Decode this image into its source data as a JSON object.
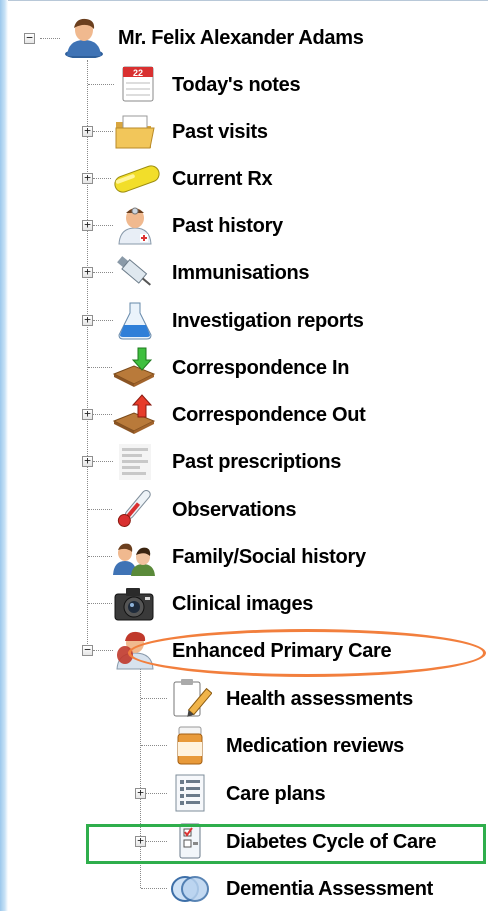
{
  "patient": {
    "name": "Mr. Felix Alexander Adams"
  },
  "items": [
    {
      "label": "Today's notes",
      "icon": "calendar-icon"
    },
    {
      "label": "Past visits",
      "icon": "folder-icon"
    },
    {
      "label": "Current Rx",
      "icon": "pill-icon"
    },
    {
      "label": "Past history",
      "icon": "doctor-icon"
    },
    {
      "label": "Immunisations",
      "icon": "syringe-icon"
    },
    {
      "label": "Investigation reports",
      "icon": "flask-icon"
    },
    {
      "label": "Correspondence In",
      "icon": "inbox-icon"
    },
    {
      "label": "Correspondence Out",
      "icon": "outbox-icon"
    },
    {
      "label": "Past prescriptions",
      "icon": "prescription-icon"
    },
    {
      "label": "Observations",
      "icon": "thermometer-icon"
    },
    {
      "label": "Family/Social history",
      "icon": "family-icon"
    },
    {
      "label": "Clinical images",
      "icon": "camera-icon"
    },
    {
      "label": "Enhanced Primary Care",
      "icon": "epc-icon"
    }
  ],
  "epc_children": [
    {
      "label": "Health assessments",
      "icon": "clipboard-pen-icon"
    },
    {
      "label": "Medication reviews",
      "icon": "pill-bottle-icon"
    },
    {
      "label": "Care plans",
      "icon": "care-plan-icon"
    },
    {
      "label": "Diabetes Cycle of Care",
      "icon": "checklist-icon"
    },
    {
      "label": "Dementia Assessment",
      "icon": "brain-scan-icon"
    }
  ],
  "highlight_colors": {
    "orange": "#f27f3d",
    "green": "#2fae4c"
  }
}
